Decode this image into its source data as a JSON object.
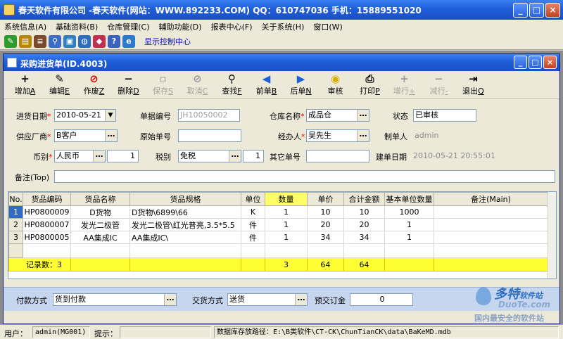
{
  "window": {
    "title": "春天软件有限公司 -春天软件(网站：WWW.892233.COM) QQ：610747036 手机：15889551020",
    "min": "_",
    "max": "□",
    "close": "×"
  },
  "menu": [
    "系统信息(A)",
    "基础资料(B)",
    "仓库管理(C)",
    "辅助功能(D)",
    "报表中心(F)",
    "关于系统(H)",
    "窗口(W)"
  ],
  "icon_toolbar": {
    "icons": [
      {
        "name": "tool-icon",
        "color": "#2e9b2e",
        "glyph": "✎"
      },
      {
        "name": "book-icon",
        "color": "#b8860b",
        "glyph": "▤"
      },
      {
        "name": "stack-icon",
        "color": "#7a4a2a",
        "glyph": "≡"
      },
      {
        "name": "search-icon",
        "color": "#3a6cc8",
        "glyph": "⚲"
      },
      {
        "name": "cube-icon",
        "color": "#3080c0",
        "glyph": "▣"
      },
      {
        "name": "globe-icon",
        "color": "#2a70b8",
        "glyph": "◍"
      },
      {
        "name": "chart-icon",
        "color": "#c03050",
        "glyph": "◆"
      },
      {
        "name": "help-icon",
        "color": "#3a60c0",
        "glyph": "?"
      },
      {
        "name": "ie-icon",
        "color": "#2a7ad0",
        "glyph": "e"
      }
    ],
    "show_console": "显示控制中心"
  },
  "child": {
    "title": "采购进货单(ID.4003)",
    "min": "_",
    "max": "□",
    "close": "×"
  },
  "actions": [
    {
      "name": "add",
      "icon": "+",
      "label": "增加",
      "key": "A",
      "color": "#000",
      "disabled": false
    },
    {
      "name": "edit",
      "icon": "✎",
      "label": "编辑",
      "key": "E",
      "color": "#000",
      "disabled": false
    },
    {
      "name": "void",
      "icon": "⊘",
      "label": "作废",
      "key": "Z",
      "color": "#d00",
      "disabled": false
    },
    {
      "name": "delete",
      "icon": "−",
      "label": "删除",
      "key": "D",
      "color": "#000",
      "disabled": false
    },
    {
      "name": "save",
      "icon": "▫",
      "label": "保存",
      "key": "S",
      "color": "#999",
      "disabled": true
    },
    {
      "name": "cancel",
      "icon": "⊘",
      "label": "取消",
      "key": "C",
      "color": "#999",
      "disabled": true
    },
    {
      "name": "find",
      "icon": "⚲",
      "label": "查找",
      "key": "F",
      "color": "#000",
      "disabled": false
    },
    {
      "name": "prev",
      "icon": "◀",
      "label": "前单",
      "key": "B",
      "color": "#1f5ed9",
      "disabled": false
    },
    {
      "name": "next",
      "icon": "▶",
      "label": "后单",
      "key": "N",
      "color": "#1f5ed9",
      "disabled": false
    },
    {
      "name": "audit",
      "icon": "◉",
      "label": "审核",
      "key": "",
      "color": "#d8b000",
      "disabled": false
    },
    {
      "name": "print",
      "icon": "⎙",
      "label": "打印",
      "key": "P",
      "color": "#000",
      "disabled": false
    },
    {
      "name": "add-row",
      "icon": "+",
      "label": "增行",
      "key": "+",
      "color": "#999",
      "disabled": true
    },
    {
      "name": "del-row",
      "icon": "−",
      "label": "减行",
      "key": "-",
      "color": "#999",
      "disabled": true
    },
    {
      "name": "exit",
      "icon": "⇥",
      "label": "退出",
      "key": "Q",
      "color": "#000",
      "disabled": false
    }
  ],
  "form": {
    "date_label": "进货日期",
    "date": "2010-05-21",
    "docno_label": "单据编号",
    "docno": "JH10050002",
    "warehouse_label": "仓库名称",
    "warehouse": "成品仓",
    "status_label": "状态",
    "status": "已审核",
    "supplier_label": "供应厂商",
    "supplier": "B客户",
    "origno_label": "原始单号",
    "origno": "",
    "handler_label": "经办人",
    "handler": "吴先生",
    "maker_label": "制单人",
    "maker": "admin",
    "currency_label": "币别",
    "currency": "人民币",
    "rate": "1",
    "tax_label": "税别",
    "tax": "免税",
    "taxrate": "1",
    "otherno_label": "其它单号",
    "otherno": "",
    "created_label": "建单日期",
    "created": "2010-05-21 20:55:01",
    "remark_label": "备注(Top)",
    "remark": ""
  },
  "watermark": "www.DuoTe.com",
  "grid": {
    "headers": [
      "No.",
      "货品编码",
      "货品名称",
      "货品规格",
      "单位",
      "数量",
      "单价",
      "合计金额",
      "基本单位数量",
      "备注(Main)"
    ],
    "rows": [
      [
        "1",
        "HP0800009",
        "D货物",
        "D货物\\6899\\66",
        "K",
        "1",
        "10",
        "10",
        "1000",
        ""
      ],
      [
        "2",
        "HP0800007",
        "发光二极管",
        "发光二极管\\红光普亮,3.5*5.5",
        "件",
        "1",
        "20",
        "20",
        "1",
        ""
      ],
      [
        "3",
        "HP0800005",
        "AA集成IC",
        "AA集成IC\\",
        "件",
        "1",
        "34",
        "34",
        "1",
        ""
      ]
    ],
    "total": {
      "label": "记录数：",
      "count": "3",
      "qty": "3",
      "price": "64",
      "amount": "64"
    }
  },
  "payment": {
    "method_label": "付款方式",
    "method": "货到付款",
    "delivery_label": "交货方式",
    "delivery": "送货",
    "deposit_label": "预交订金",
    "deposit": "0"
  },
  "logo": {
    "line1": "多特",
    "line1_small": "软件站",
    "line2": "DuoTe.com",
    "line3": "国内最安全的软件站"
  },
  "statusbar": {
    "user_label": "用户：",
    "user": "admin(MG001)",
    "hint_label": "提示：",
    "hint": "",
    "db_path": "数据库存放路径：E:\\B类软件\\CT-CK\\ChunTianCK\\data\\BaKeMD.mdb"
  }
}
